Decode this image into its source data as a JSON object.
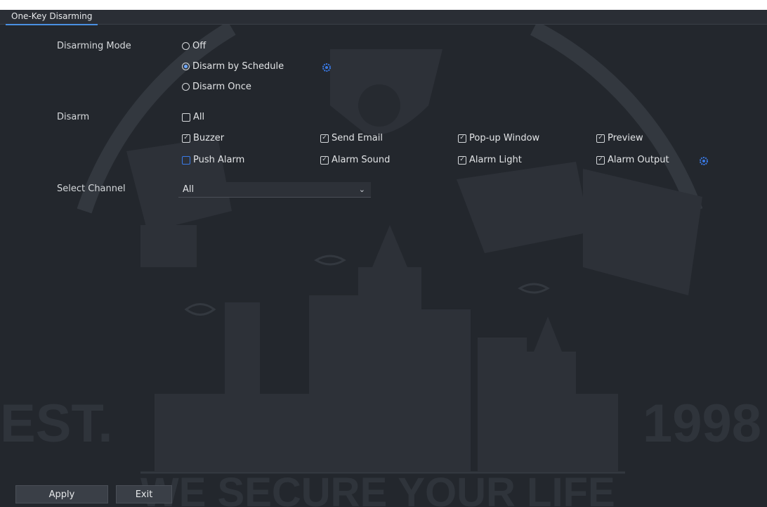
{
  "tab": {
    "label": "One-Key Disarming"
  },
  "disarming_mode": {
    "label": "Disarming Mode",
    "options": [
      {
        "label": "Off",
        "selected": false
      },
      {
        "label": "Disarm by Schedule",
        "selected": true
      },
      {
        "label": "Disarm Once",
        "selected": false
      }
    ],
    "settings_icon": "gear-icon"
  },
  "disarm": {
    "label": "Disarm",
    "all": {
      "label": "All",
      "checked": false
    },
    "items": [
      {
        "label": "Buzzer",
        "checked": true
      },
      {
        "label": "Send Email",
        "checked": true
      },
      {
        "label": "Pop-up Window",
        "checked": true
      },
      {
        "label": "Preview",
        "checked": true
      },
      {
        "label": "Push Alarm",
        "checked": false
      },
      {
        "label": "Alarm Sound",
        "checked": true
      },
      {
        "label": "Alarm Light",
        "checked": true
      },
      {
        "label": "Alarm Output",
        "checked": true
      }
    ],
    "settings_icon": "gear-icon"
  },
  "select_channel": {
    "label": "Select Channel",
    "value": "All"
  },
  "buttons": {
    "apply": "Apply",
    "exit": "Exit"
  },
  "watermark": {
    "left": "EST.",
    "right": "1998",
    "slogan": "WE SECURE YOUR LIFE"
  },
  "colors": {
    "background": "#23272d",
    "accent": "#4a90e2",
    "checkbox_blue": "#3a7be8"
  }
}
